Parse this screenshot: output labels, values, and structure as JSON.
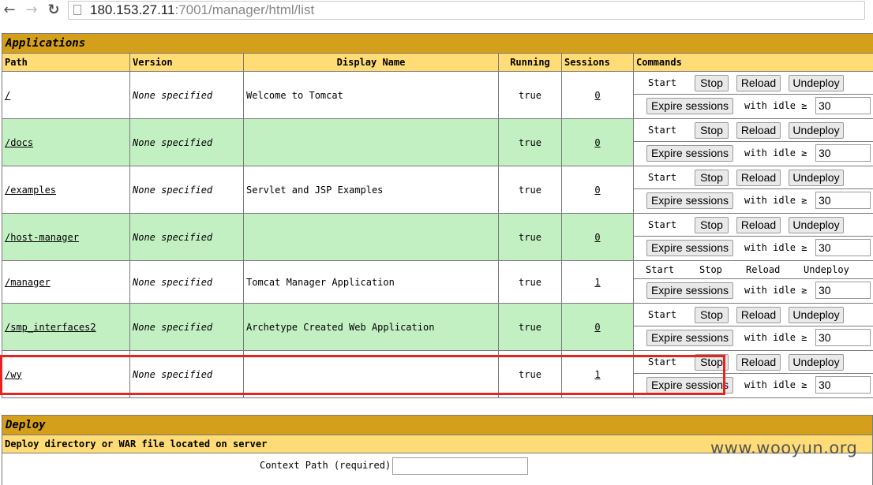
{
  "browser": {
    "back_icon": "←",
    "forward_icon": "→",
    "reload_icon": "↻",
    "url_host": "180.153.27.11",
    "url_rest": ":7001/manager/html/list"
  },
  "applications": {
    "title": "Applications",
    "headers": {
      "path": "Path",
      "version": "Version",
      "display_name": "Display Name",
      "running": "Running",
      "sessions": "Sessions",
      "commands": "Commands"
    },
    "rows": [
      {
        "path": "/",
        "version": "None specified",
        "display_name": "Welcome to Tomcat",
        "running": "true",
        "sessions": "0"
      },
      {
        "path": "/docs",
        "version": "None specified",
        "display_name": "",
        "running": "true",
        "sessions": "0"
      },
      {
        "path": "/examples",
        "version": "None specified",
        "display_name": "Servlet and JSP Examples",
        "running": "true",
        "sessions": "0"
      },
      {
        "path": "/host-manager",
        "version": "None specified",
        "display_name": "",
        "running": "true",
        "sessions": "0"
      },
      {
        "path": "/manager",
        "version": "None specified",
        "display_name": "Tomcat Manager Application",
        "running": "true",
        "sessions": "1"
      },
      {
        "path": "/smp_interfaces2",
        "version": "None specified",
        "display_name": "Archetype Created Web Application",
        "running": "true",
        "sessions": "0"
      },
      {
        "path": "/wy",
        "version": "None specified",
        "display_name": "",
        "running": "true",
        "sessions": "1"
      }
    ],
    "commands": {
      "start": "Start",
      "stop": "Stop",
      "reload": "Reload",
      "undeploy": "Undeploy",
      "expire": "Expire sessions",
      "with_idle": "with idle ≥",
      "idle_value": "30"
    }
  },
  "deploy": {
    "title": "Deploy",
    "subtitle": "Deploy directory or WAR file located on server",
    "context_path_label": "Context Path (required):"
  },
  "watermark": "www.wooyun.org",
  "colors": {
    "title_bg": "#d4a01c",
    "header_bg": "#ffdc75",
    "row_alt_bg": "#c3f0c3",
    "highlight": "#e8231f"
  }
}
